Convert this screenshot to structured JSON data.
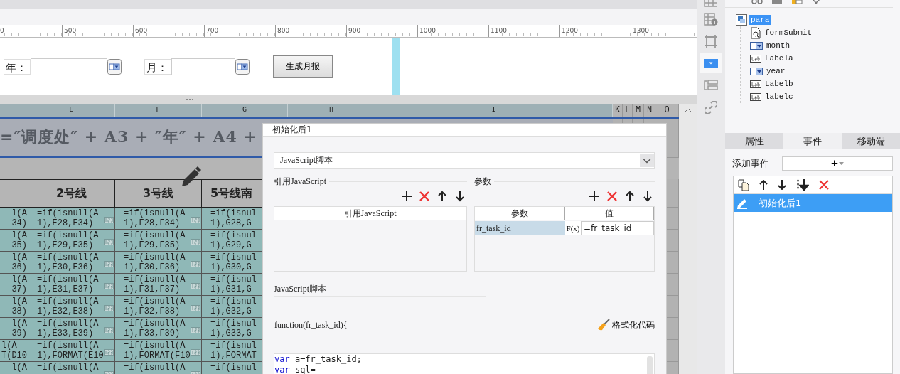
{
  "ruler": {
    "labels": [
      "0",
      "500",
      "600",
      "700",
      "800",
      "900",
      "1000",
      "1100",
      "1200",
      "1300"
    ]
  },
  "form": {
    "fields": [
      {
        "label": "年："
      },
      {
        "label": "月："
      }
    ],
    "button": "生成月报"
  },
  "sheet": {
    "column_letters": [
      "E",
      "F",
      "G",
      "H",
      "I",
      "K",
      "L",
      "M",
      "N",
      "O"
    ],
    "title_formula": "=″调度处″ + A3 + ″年″ + A4 +",
    "header_cells": [
      "2号线",
      "3号线",
      "5号线南"
    ],
    "rows": [
      [
        {
          "l1": "l(A",
          "l2": "34)"
        },
        {
          "l1": "=if(isnull(A",
          "l2": "1),E28,E34)"
        },
        {
          "l1": "=if(isnull(A",
          "l2": "1),F28,F34)"
        },
        {
          "l1": "=if(isnul",
          "l2": "1),G28,G"
        }
      ],
      [
        {
          "l1": "l(A",
          "l2": "35)"
        },
        {
          "l1": "=if(isnull(A",
          "l2": "1),E29,E35)"
        },
        {
          "l1": "=if(isnull(A",
          "l2": "1),F29,F35)"
        },
        {
          "l1": "=if(isnul",
          "l2": "1),G29,G"
        }
      ],
      [
        {
          "l1": "l(A",
          "l2": "36)"
        },
        {
          "l1": "=if(isnull(A",
          "l2": "1),E30,E36)"
        },
        {
          "l1": "=if(isnull(A",
          "l2": "1),F30,F36)"
        },
        {
          "l1": "=if(isnul",
          "l2": "1),G30,G"
        }
      ],
      [
        {
          "l1": "l(A",
          "l2": "37)"
        },
        {
          "l1": "=if(isnull(A",
          "l2": "1),E31,E37)"
        },
        {
          "l1": "=if(isnull(A",
          "l2": "1),F31,F37)"
        },
        {
          "l1": "=if(isnul",
          "l2": "1),G31,G"
        }
      ],
      [
        {
          "l1": "l(A",
          "l2": "38)"
        },
        {
          "l1": "=if(isnull(A",
          "l2": "1),E32,E38)"
        },
        {
          "l1": "=if(isnull(A",
          "l2": "1),F32,F38)"
        },
        {
          "l1": "=if(isnul",
          "l2": "1),G32,G"
        }
      ],
      [
        {
          "l1": "l(A",
          "l2": "39)"
        },
        {
          "l1": "=if(isnull(A",
          "l2": "1),E33,E39)"
        },
        {
          "l1": "=if(isnull(A",
          "l2": "1),F33,F39)"
        },
        {
          "l1": "=if(isnul",
          "l2": "1),G33,G"
        }
      ],
      [
        {
          "l1": "l(A",
          "l2": "T(D10"
        },
        {
          "l1": "=if(isnull(A",
          "l2": "1),FORMAT(E10"
        },
        {
          "l1": "=if(isnull(A",
          "l2": "1),FORMAT(F10"
        },
        {
          "l1": "=if(isnul",
          "l2": "1),FORMAT"
        }
      ],
      [
        {
          "l1": "l(A"
        },
        {
          "l1": "=if(isnull(A"
        },
        {
          "l1": "=if(isnull(A"
        },
        {
          "l1": "=if(isnul"
        }
      ]
    ]
  },
  "dialog": {
    "title": "初始化后1",
    "type_select": "JavaScript脚本",
    "ref_section": {
      "legend": "引用JavaScript",
      "column": "引用JavaScript"
    },
    "param_section": {
      "legend": "参数",
      "columns": [
        "参数",
        "值"
      ],
      "rows": [
        {
          "name": "fr_task_id",
          "formula_button": "F(x)",
          "value": "=fr_task_id",
          "selected": true
        }
      ]
    },
    "script_section": {
      "legend": "JavaScript脚本",
      "signature": "function(fr_task_id){",
      "format_button": "格式化代码",
      "code": [
        [
          {
            "kind": "keyword",
            "text": "var"
          },
          {
            "kind": "plain",
            "text": " a=fr_task_id;"
          }
        ],
        [
          {
            "kind": "keyword",
            "text": "var"
          },
          {
            "kind": "plain",
            "text": " sql="
          }
        ]
      ]
    }
  },
  "side_tools": [
    {
      "selected": false
    },
    {
      "selected": false
    },
    {
      "selected": false
    },
    {
      "selected": true
    },
    {
      "selected": false
    },
    {
      "selected": false
    }
  ],
  "tree": {
    "label": "para",
    "selected": true,
    "children": [
      {
        "label": "formSubmit",
        "kind": "submit",
        "selected": false
      },
      {
        "label": "month",
        "kind": "combo",
        "selected": false
      },
      {
        "label": "Labela",
        "kind": "label",
        "selected": false
      },
      {
        "label": "year",
        "kind": "combo",
        "selected": false
      },
      {
        "label": "Labelb",
        "kind": "label",
        "selected": false
      },
      {
        "label": "labelc",
        "kind": "label",
        "selected": false
      }
    ]
  },
  "tabs": [
    {
      "label": "属性",
      "selected": false
    },
    {
      "label": "事件",
      "selected": true
    },
    {
      "label": "移动端",
      "selected": false
    }
  ],
  "add_event": {
    "label": "添加事件",
    "button": "+"
  },
  "events": [
    {
      "label": "初始化后1",
      "selected": true
    }
  ]
}
